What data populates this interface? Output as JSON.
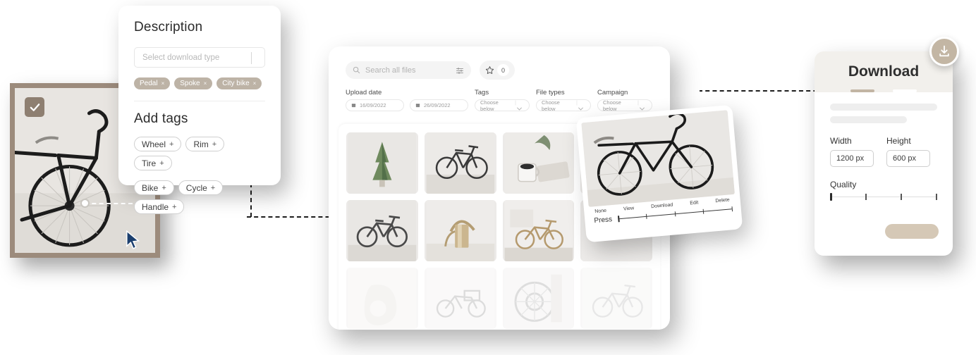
{
  "description_panel": {
    "title": "Description",
    "input_placeholder": "Select download type",
    "input_value": "",
    "tags": [
      {
        "label": "Pedal",
        "remove": "×"
      },
      {
        "label": "Spoke",
        "remove": "×"
      },
      {
        "label": "City bike",
        "remove": "×"
      }
    ],
    "add_tags_title": "Add tags",
    "add_tags": [
      {
        "label": "Wheel",
        "add": "+"
      },
      {
        "label": "Rim",
        "add": "+"
      },
      {
        "label": "Tire",
        "add": "+"
      },
      {
        "label": "Bike",
        "add": "+"
      },
      {
        "label": "Cycle",
        "add": "+"
      },
      {
        "label": "Handle",
        "add": "+"
      }
    ]
  },
  "browser_panel": {
    "search_placeholder": "Search all files",
    "search_value": "",
    "search_icon": "search-icon",
    "filter_icon": "sliders-icon",
    "favorite_icon": "star-icon",
    "favorite_count": "0",
    "filters": {
      "upload_date_label": "Upload date",
      "date_from": "16/09/2022",
      "date_to": "26/09/2022",
      "tags_label": "Tags",
      "tags_value": "Choose below",
      "file_types_label": "File types",
      "file_types_value": "Choose below",
      "campaign_label": "Campaign",
      "campaign_value": "Choose below"
    },
    "thumbnails": [
      "conifer-plant",
      "white-bicycle-wall",
      "coffee-cup-magazine",
      "hidden-thumb",
      "grey-road-bike",
      "brass-watering-can",
      "bike-against-wall",
      "hidden-thumb-2",
      "white-vase",
      "cargo-bike",
      "disc-brake-rotor",
      "faded-bicycle"
    ]
  },
  "detail_card": {
    "photo": "black-road-bicycle",
    "press_label": "Press",
    "slider_ticks": [
      "None",
      "View",
      "Download",
      "Edit",
      "Delete"
    ],
    "slider_value": "None"
  },
  "download_panel": {
    "title": "Download",
    "badge_icon": "download-icon",
    "tabs": [
      {
        "name": "tab-active",
        "state": "active"
      },
      {
        "name": "tab-idle",
        "state": "idle"
      }
    ],
    "width_label": "Width",
    "width_value": "1200 px",
    "height_label": "Height",
    "height_value": "600 px",
    "quality_label": "Quality",
    "quality_ticks": 4,
    "quality_value": "0"
  },
  "left_card": {
    "photo": "selected-bicycle-photo",
    "checkbox_state": "checked",
    "checkbox_icon": "check-icon",
    "cursor_icon": "cursor-arrow-icon"
  },
  "colors": {
    "accent_taupe": "#bdb3a6",
    "frame_brown": "#9c8b7c",
    "panel_bg": "#ffffff",
    "header_bg": "#f2f0ec",
    "button_taupe": "#d5c8b6"
  }
}
